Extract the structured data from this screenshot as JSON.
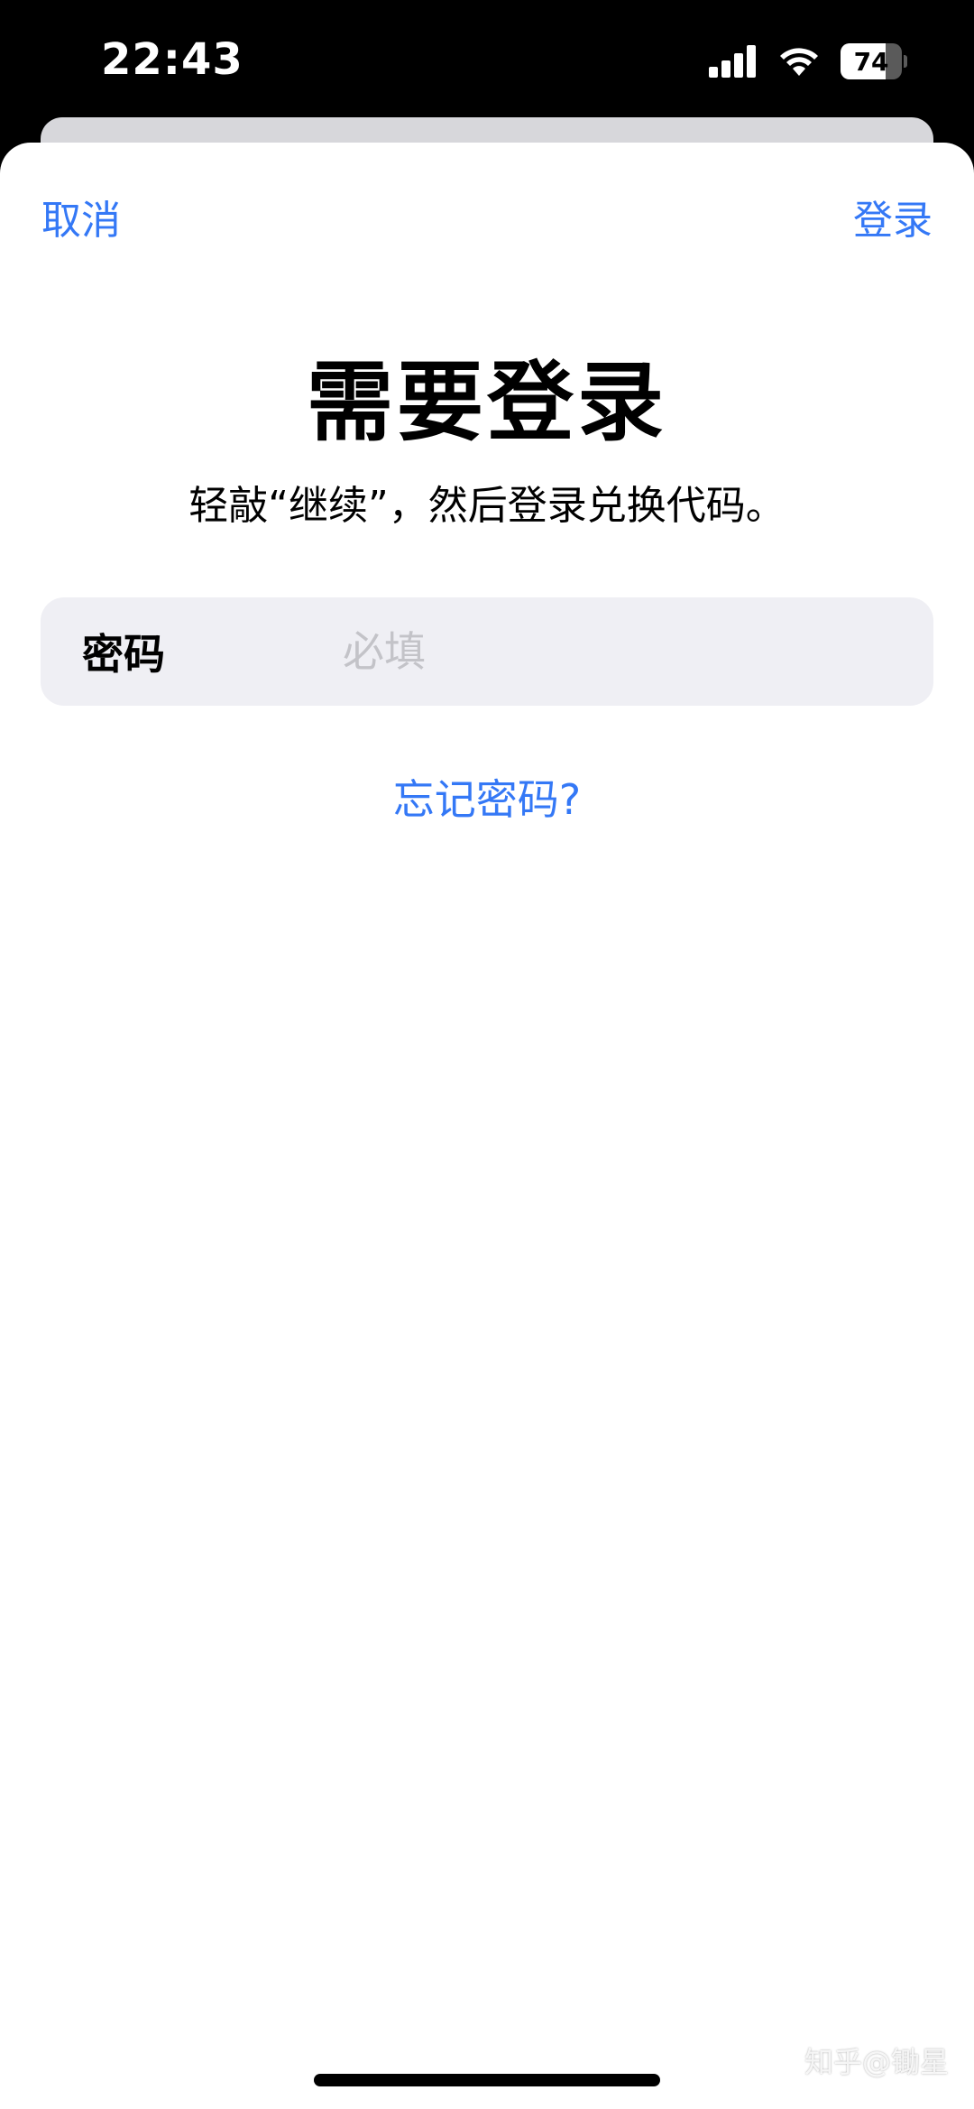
{
  "status_bar": {
    "time": "22:43",
    "battery": "74",
    "battery_level": 0.74,
    "icons": [
      "cellular-signal-icon",
      "wifi-icon",
      "battery-icon"
    ]
  },
  "sheet": {
    "cancel_label": "取消",
    "login_label": "登录",
    "title": "需要登录",
    "subtitle": "轻敲“继续”，然后登录兑换代码。",
    "password_field": {
      "label": "密码",
      "placeholder": "必填",
      "value": ""
    },
    "forgot_label": "忘记密码?"
  },
  "watermark": "知乎@锄星",
  "colors": {
    "accent": "#3478f6",
    "field_bg": "#efeff4",
    "placeholder": "#c3c3c8"
  }
}
